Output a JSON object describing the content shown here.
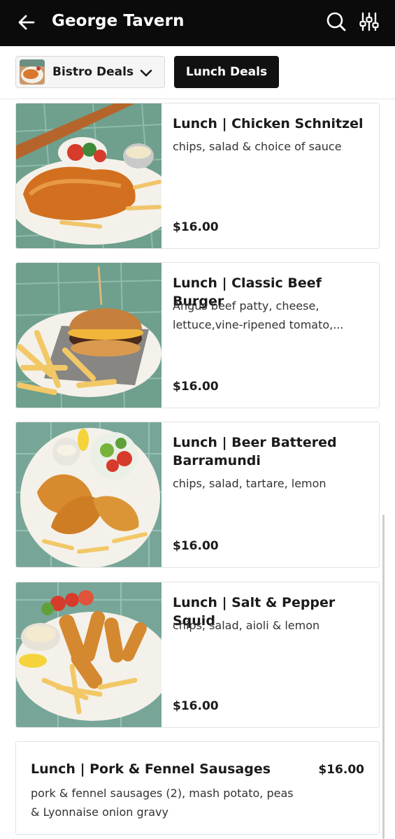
{
  "header": {
    "title": "George Tavern",
    "back_icon": "arrow-left-icon",
    "search_icon": "search-icon",
    "filter_icon": "sliders-icon"
  },
  "menu_bar": {
    "selected_menu": "Bistro Deals",
    "active_category": "Lunch Deals"
  },
  "items": [
    {
      "name": "Lunch | Chicken Schnitzel",
      "description": "chips, salad & choice of sauce",
      "price": "$16.00"
    },
    {
      "name": "Lunch | Classic Beef Burger",
      "description": "Angus beef patty, cheese, lettuce,vine-ripened tomato,...",
      "price": "$16.00"
    },
    {
      "name": "Lunch | Beer Battered Barramundi",
      "description": "chips, salad, tartare, lemon",
      "price": "$16.00"
    },
    {
      "name": "Lunch | Salt & Pepper Squid",
      "description": "chips, salad, aioli & lemon",
      "price": "$16.00"
    },
    {
      "name": "Lunch | Pork & Fennel Sausages",
      "description": "pork & fennel sausages (2), mash potato, peas & Lyonnaise onion gravy",
      "price": "$16.00"
    }
  ],
  "colors": {
    "header_bg": "#0b0b0b",
    "chip_bg": "#111111",
    "tile_green": "#6d9e8c"
  }
}
